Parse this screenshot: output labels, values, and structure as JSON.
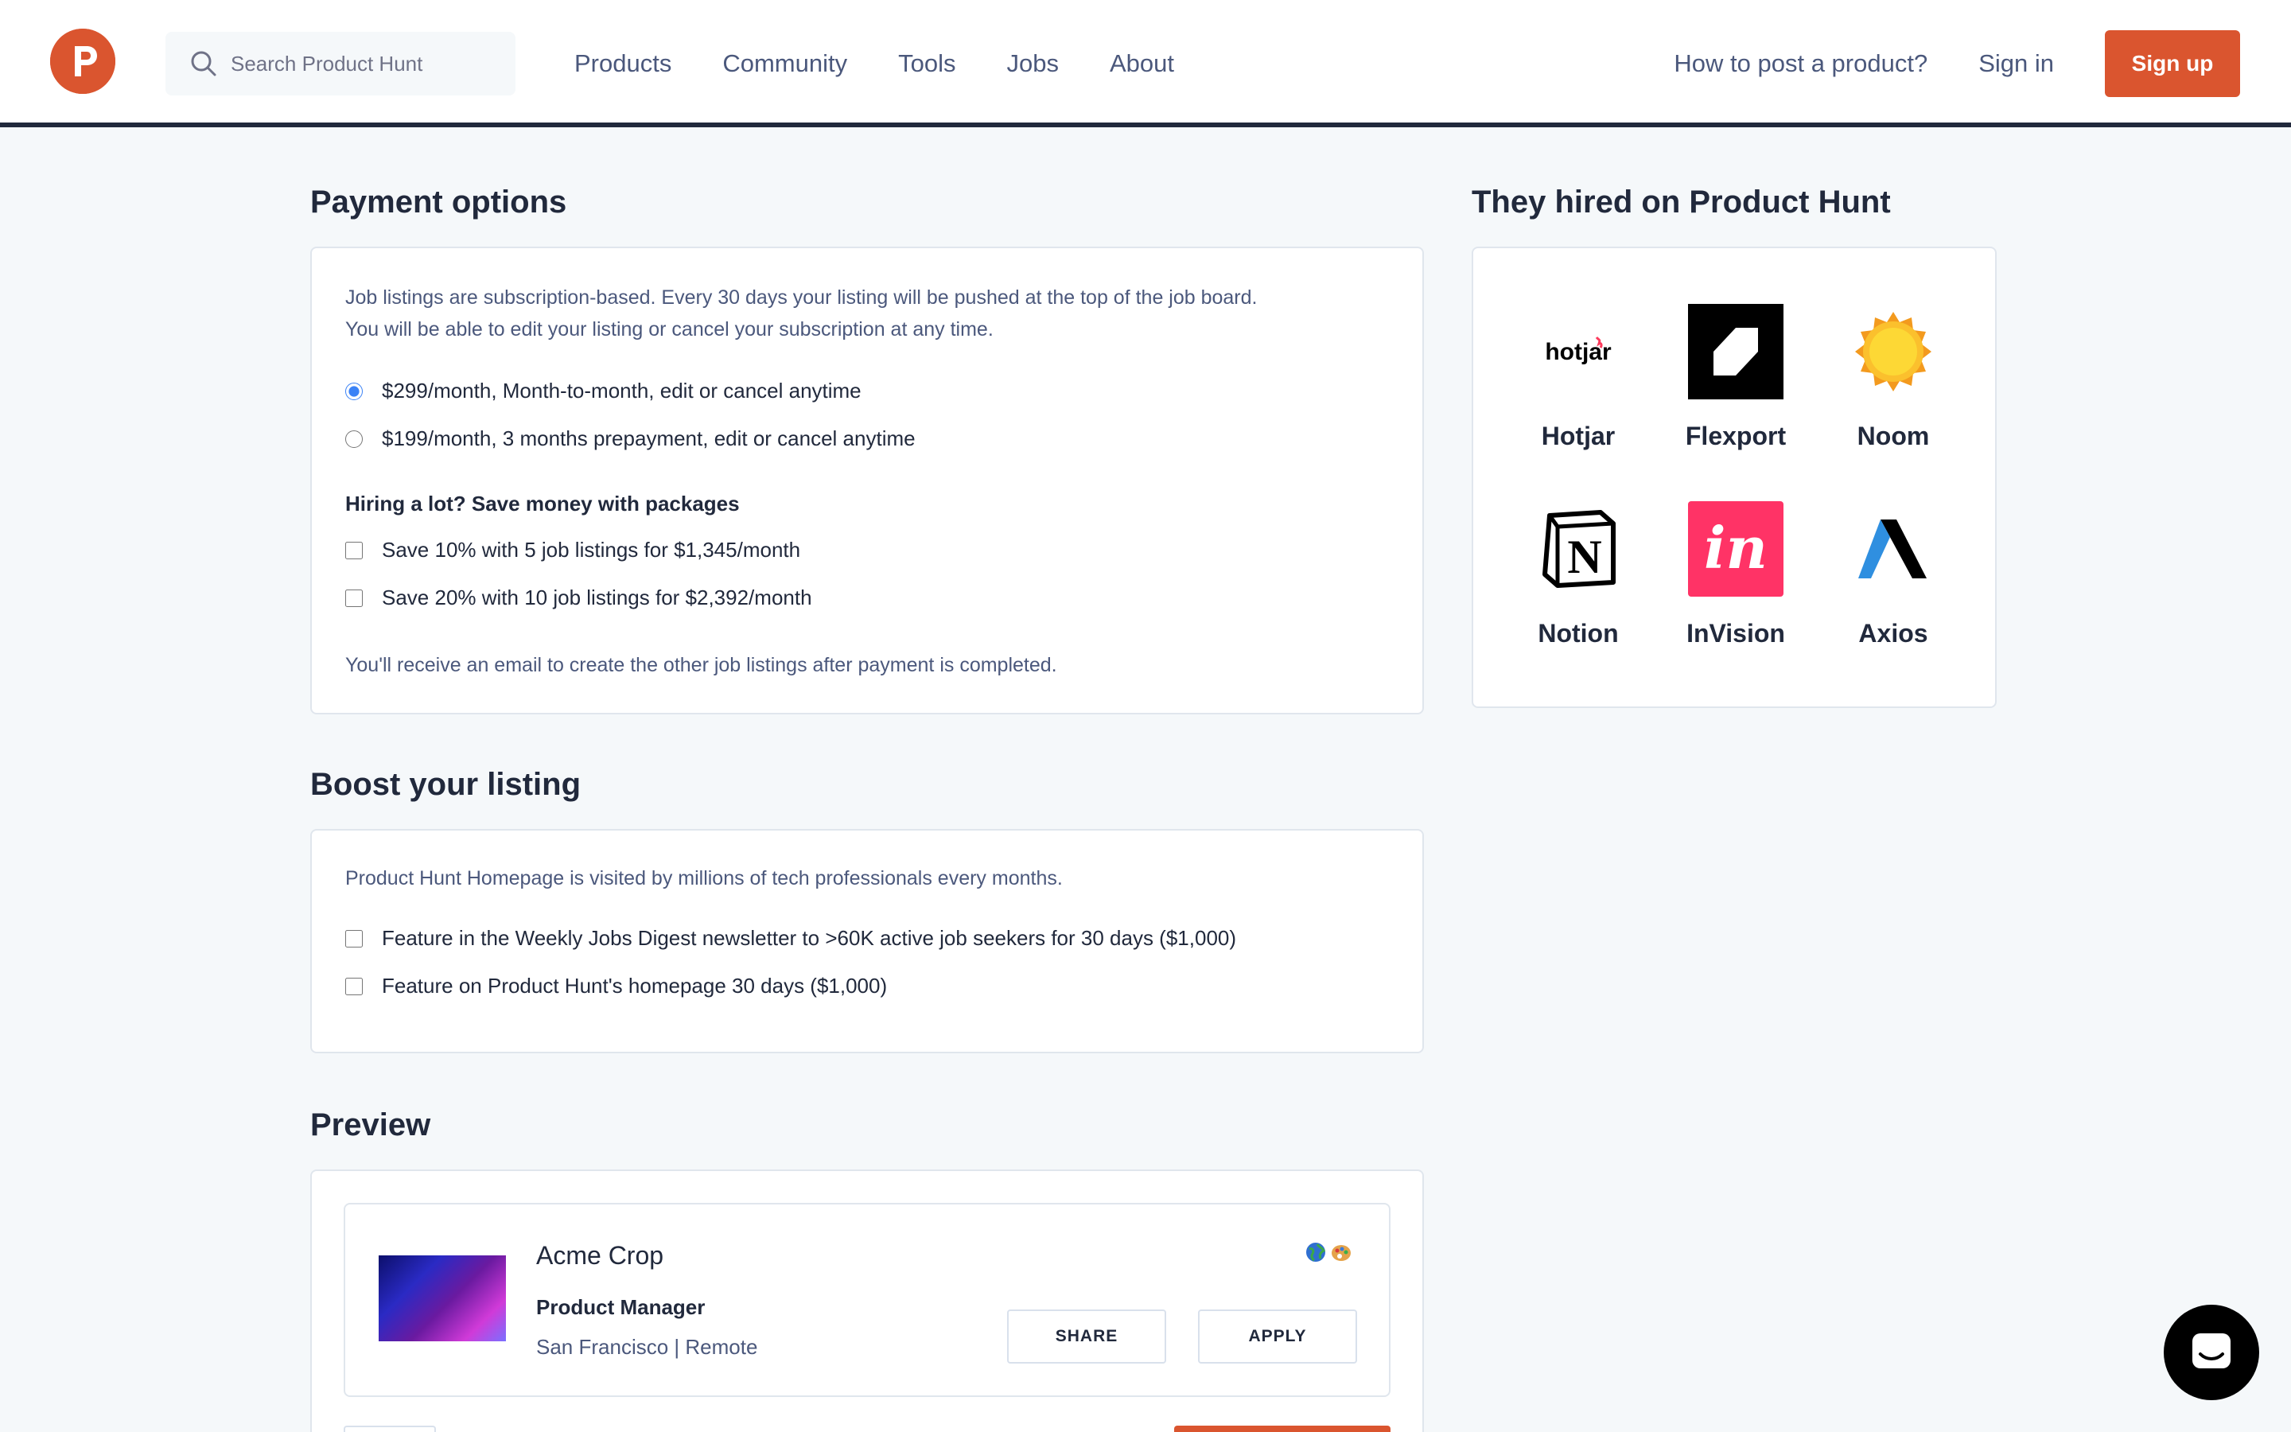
{
  "header": {
    "search_placeholder": "Search Product Hunt",
    "nav": [
      "Products",
      "Community",
      "Tools",
      "Jobs",
      "About"
    ],
    "how_to_post": "How to post a product?",
    "sign_in": "Sign in",
    "sign_up": "Sign up"
  },
  "payment": {
    "title": "Payment options",
    "description_line1": "Job listings are subscription-based. Every 30 days your listing will be pushed at the top of the job board.",
    "description_line2": "You will be able to edit your listing or cancel your subscription at any time.",
    "plans": [
      {
        "label": "$299/month, Month-to-month, edit or cancel anytime",
        "selected": true
      },
      {
        "label": "$199/month, 3 months prepayment, edit or cancel anytime",
        "selected": false
      }
    ],
    "packages_title": "Hiring a lot? Save money with packages",
    "packages": [
      "Save 10% with 5 job listings for $1,345/month",
      "Save 20% with 10 job listings for $2,392/month"
    ],
    "note": "You'll receive an email to create the other job listings after payment is completed."
  },
  "boost": {
    "title": "Boost your listing",
    "description": "Product Hunt Homepage is visited by millions of tech professionals every months.",
    "options": [
      "Feature in the Weekly Jobs Digest newsletter to >60K active job seekers for 30 days ($1,000)",
      "Feature on Product Hunt's homepage 30 days ($1,000)"
    ]
  },
  "hired": {
    "title": "They hired on Product Hunt",
    "companies": [
      {
        "name": "Hotjar",
        "logo_text": "hotjar"
      },
      {
        "name": "Flexport"
      },
      {
        "name": "Noom"
      },
      {
        "name": "Notion",
        "logo_text": "N"
      },
      {
        "name": "InVision",
        "logo_text": "in"
      },
      {
        "name": "Axios"
      }
    ]
  },
  "preview": {
    "title": "Preview",
    "company": "Acme Crop",
    "role": "Product Manager",
    "location": "San Francisco | Remote",
    "share_label": "SHARE",
    "apply_label": "APPLY"
  },
  "colors": {
    "brand": "#da552f",
    "text": "#21293c",
    "muted": "#4b587c",
    "invision": "#ff3366"
  }
}
